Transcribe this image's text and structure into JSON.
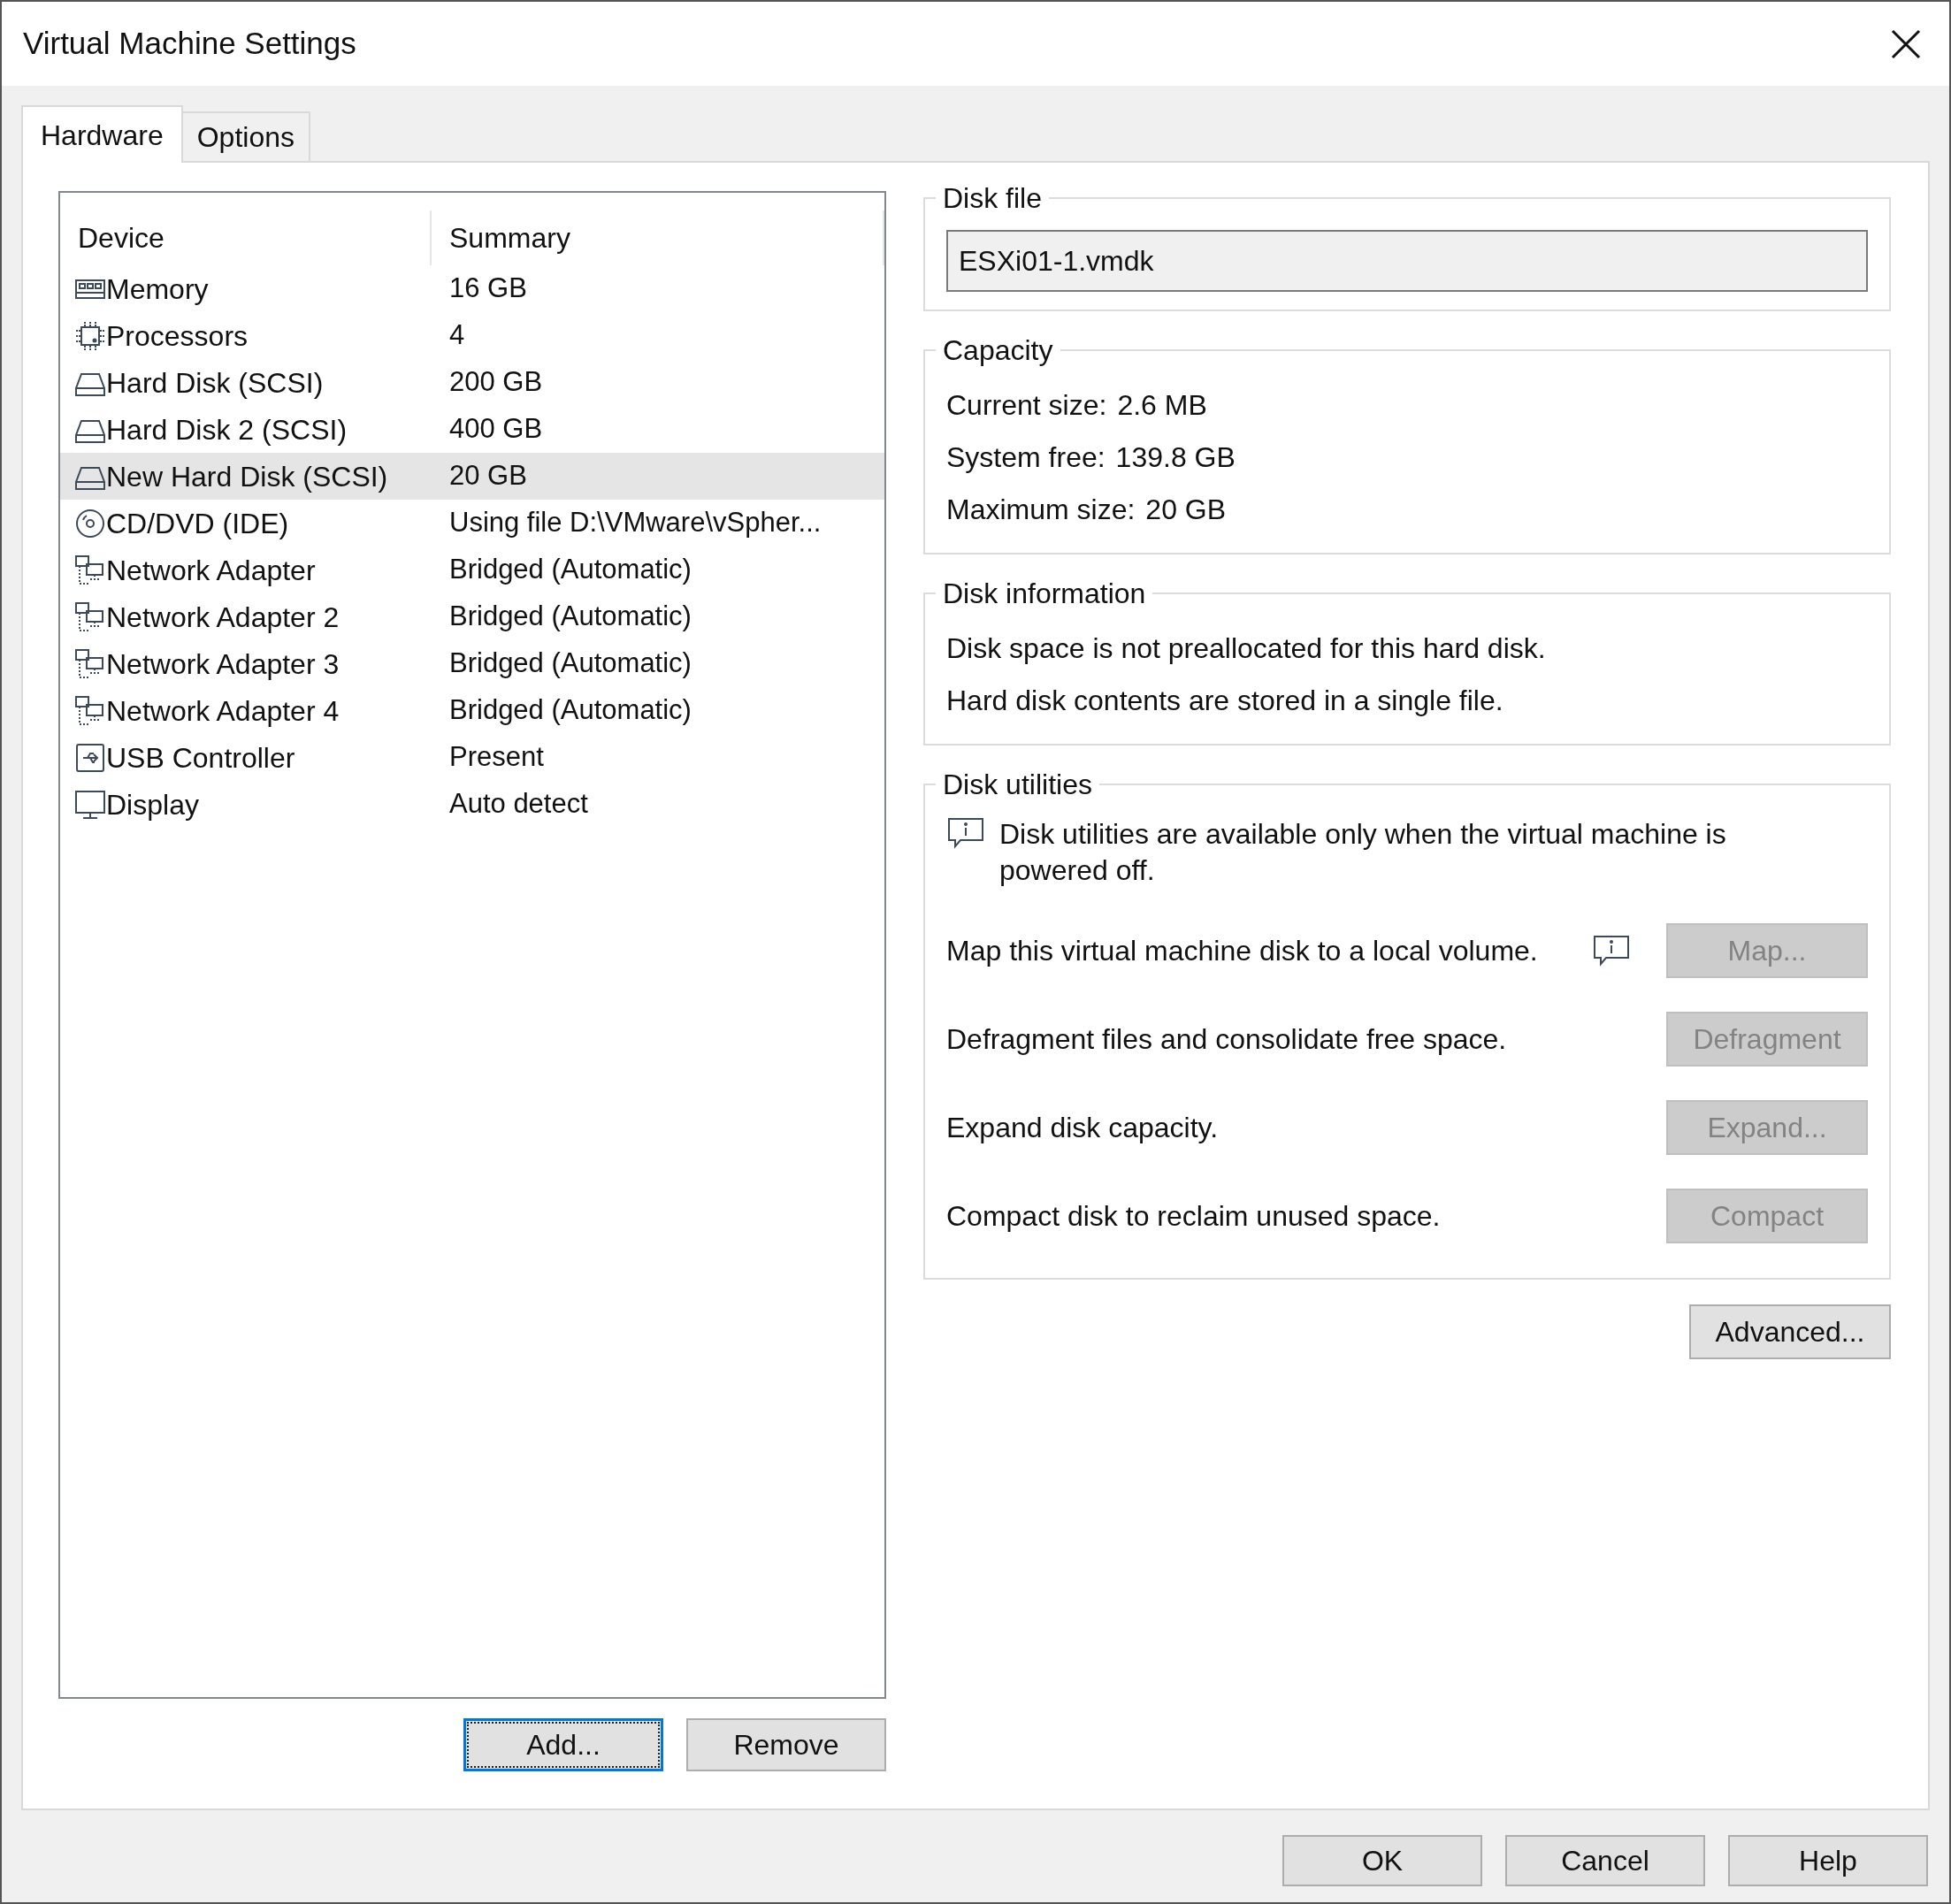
{
  "window": {
    "title": "Virtual Machine Settings"
  },
  "tabs": [
    {
      "label": "Hardware",
      "selected": true
    },
    {
      "label": "Options",
      "selected": false
    }
  ],
  "device_table": {
    "columns": [
      "Device",
      "Summary"
    ],
    "rows": [
      {
        "kind": "memory",
        "device": "Memory",
        "summary": "16 GB",
        "selected": false
      },
      {
        "kind": "processor",
        "device": "Processors",
        "summary": "4",
        "selected": false
      },
      {
        "kind": "disk",
        "device": "Hard Disk (SCSI)",
        "summary": "200 GB",
        "selected": false
      },
      {
        "kind": "disk",
        "device": "Hard Disk 2 (SCSI)",
        "summary": "400 GB",
        "selected": false
      },
      {
        "kind": "disk",
        "device": "New Hard Disk (SCSI)",
        "summary": "20 GB",
        "selected": true
      },
      {
        "kind": "cdrom",
        "device": "CD/DVD (IDE)",
        "summary": "Using file D:\\VMware\\vSpher...",
        "selected": false
      },
      {
        "kind": "network",
        "device": "Network Adapter",
        "summary": "Bridged (Automatic)",
        "selected": false
      },
      {
        "kind": "network",
        "device": "Network Adapter 2",
        "summary": "Bridged (Automatic)",
        "selected": false
      },
      {
        "kind": "network",
        "device": "Network Adapter 3",
        "summary": "Bridged (Automatic)",
        "selected": false
      },
      {
        "kind": "network",
        "device": "Network Adapter 4",
        "summary": "Bridged (Automatic)",
        "selected": false
      },
      {
        "kind": "usb",
        "device": "USB Controller",
        "summary": "Present",
        "selected": false
      },
      {
        "kind": "display",
        "device": "Display",
        "summary": "Auto detect",
        "selected": false
      }
    ]
  },
  "list_buttons": [
    {
      "label": "Add...",
      "focused": true
    },
    {
      "label": "Remove",
      "focused": false
    }
  ],
  "disk_file": {
    "title": "Disk file",
    "value": "ESXi01-1.vmdk"
  },
  "capacity": {
    "title": "Capacity",
    "rows": [
      {
        "label": "Current size:",
        "value": "2.6 MB"
      },
      {
        "label": "System free:",
        "value": "139.8 GB"
      },
      {
        "label": "Maximum size:",
        "value": "20 GB"
      }
    ]
  },
  "disk_information": {
    "title": "Disk information",
    "lines": [
      "Disk space is not preallocated for this hard disk.",
      "Hard disk contents are stored in a single file."
    ]
  },
  "disk_utilities": {
    "title": "Disk utilities",
    "notice": "Disk utilities are available only when the virtual machine is powered off.",
    "actions": [
      {
        "description": "Map this virtual machine disk to a local volume.",
        "button": "Map...",
        "disabled": true,
        "info": true
      },
      {
        "description": "Defragment files and consolidate free space.",
        "button": "Defragment",
        "disabled": true,
        "info": false
      },
      {
        "description": "Expand disk capacity.",
        "button": "Expand...",
        "disabled": true,
        "info": false
      },
      {
        "description": "Compact disk to reclaim unused space.",
        "button": "Compact",
        "disabled": true,
        "info": false
      }
    ]
  },
  "advanced_button": "Advanced...",
  "dialog_buttons": [
    "OK",
    "Cancel",
    "Help"
  ]
}
